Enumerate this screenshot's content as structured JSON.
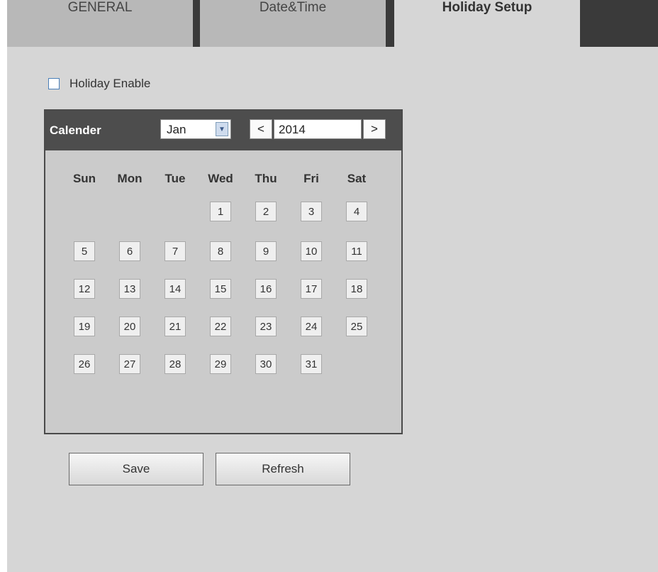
{
  "tabs": [
    {
      "label": "GENERAL",
      "active": false
    },
    {
      "label": "Date&Time",
      "active": false
    },
    {
      "label": "Holiday Setup",
      "active": true
    }
  ],
  "holiday": {
    "enable_label": "Holiday Enable",
    "enabled": false
  },
  "calendar": {
    "title": "Calender",
    "month": "Jan",
    "year": "2014",
    "prev_label": "<",
    "next_label": ">",
    "weekdays": [
      "Sun",
      "Mon",
      "Tue",
      "Wed",
      "Thu",
      "Fri",
      "Sat"
    ],
    "first_weekday_index": 3,
    "days_in_month": 31
  },
  "buttons": {
    "save": "Save",
    "refresh": "Refresh"
  },
  "colors": {
    "panel_bg": "#d6d6d6",
    "tab_inactive": "#b8b8b8",
    "header_dark": "#4d4d4d",
    "checkbox_border": "#4a7fb8"
  }
}
